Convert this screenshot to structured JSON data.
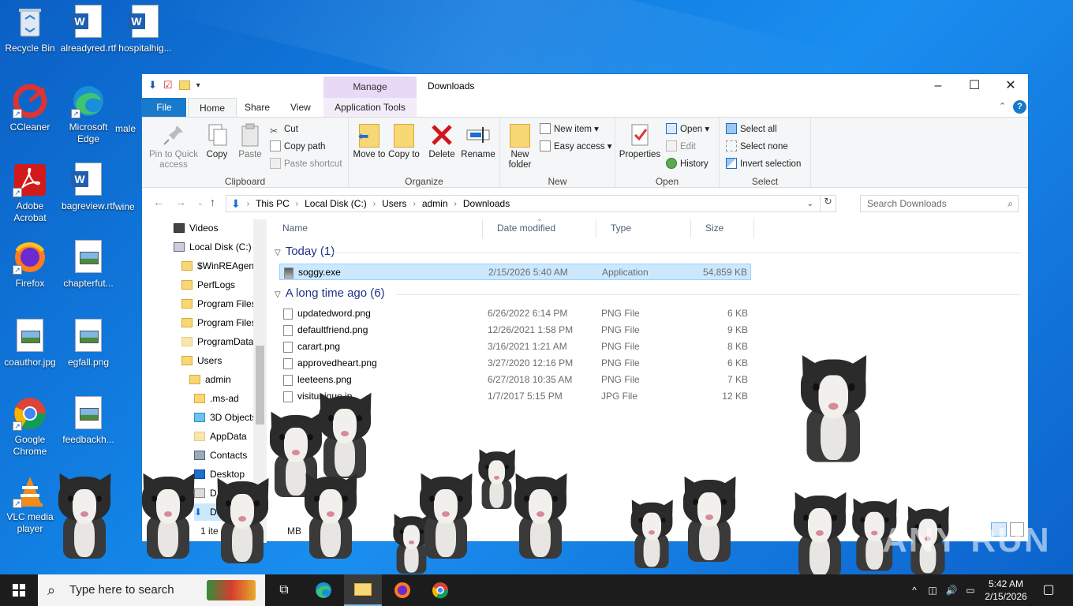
{
  "desktop": {
    "icons": [
      {
        "label": "Recycle Bin"
      },
      {
        "label": "alreadyred.rtf"
      },
      {
        "label": "hospitalhig..."
      },
      {
        "label": "CCleaner"
      },
      {
        "label": "Microsoft Edge"
      },
      {
        "label": "male"
      },
      {
        "label": "Adobe Acrobat"
      },
      {
        "label": "bagreview.rtf"
      },
      {
        "label": "wine"
      },
      {
        "label": "Firefox"
      },
      {
        "label": "chapterfut..."
      },
      {
        "label": "coauthor.jpg"
      },
      {
        "label": "egfall.png"
      },
      {
        "label": "Google Chrome"
      },
      {
        "label": "feedbackh..."
      },
      {
        "label": "VLC media player"
      }
    ]
  },
  "window": {
    "title": "Downloads",
    "context_tab": "Manage",
    "tabs": {
      "file": "File",
      "home": "Home",
      "share": "Share",
      "view": "View",
      "app_tools": "Application Tools"
    },
    "ribbon": {
      "clipboard": {
        "label": "Clipboard",
        "pin": "Pin to Quick access",
        "copy": "Copy",
        "paste": "Paste",
        "cut": "Cut",
        "copy_path": "Copy path",
        "paste_shortcut": "Paste shortcut"
      },
      "organize": {
        "label": "Organize",
        "move_to": "Move to",
        "copy_to": "Copy to",
        "delete": "Delete",
        "rename": "Rename"
      },
      "new": {
        "label": "New",
        "new_folder": "New folder",
        "new_item": "New item",
        "easy_access": "Easy access"
      },
      "open": {
        "label": "Open",
        "properties": "Properties",
        "open": "Open",
        "edit": "Edit",
        "history": "History"
      },
      "select": {
        "label": "Select",
        "select_all": "Select all",
        "select_none": "Select none",
        "invert": "Invert selection"
      }
    },
    "address": {
      "crumbs": [
        "This PC",
        "Local Disk (C:)",
        "Users",
        "admin",
        "Downloads"
      ],
      "search_placeholder": "Search Downloads"
    },
    "nav": [
      "Videos",
      "Local Disk (C:)",
      "$WinREAgent",
      "PerfLogs",
      "Program Files",
      "Program Files",
      "ProgramData",
      "Users",
      "admin",
      ".ms-ad",
      "3D Objects",
      "AppData",
      "Contacts",
      "Desktop",
      "D",
      "Do"
    ],
    "columns": {
      "name": "Name",
      "date": "Date modified",
      "type": "Type",
      "size": "Size"
    },
    "groups": [
      {
        "title": "Today (1)",
        "files": [
          {
            "name": "soggy.exe",
            "date": "2/15/2026 5:40 AM",
            "type": "Application",
            "size": "54,859 KB",
            "selected": true
          }
        ]
      },
      {
        "title": "A long time ago (6)",
        "files": [
          {
            "name": "updatedword.png",
            "date": "6/26/2022 6:14 PM",
            "type": "PNG File",
            "size": "6 KB"
          },
          {
            "name": "defaultfriend.png",
            "date": "12/26/2021 1:58 PM",
            "type": "PNG File",
            "size": "9 KB"
          },
          {
            "name": "carart.png",
            "date": "3/16/2021 1:21 AM",
            "type": "PNG File",
            "size": "8 KB"
          },
          {
            "name": "approvedheart.png",
            "date": "3/27/2020 12:16 PM",
            "type": "PNG File",
            "size": "6 KB"
          },
          {
            "name": "leeteens.png",
            "date": "6/27/2018 10:35 AM",
            "type": "PNG File",
            "size": "7 KB"
          },
          {
            "name": "visitunique.jp",
            "date": "1/7/2017 5:15 PM",
            "type": "JPG File",
            "size": "12 KB"
          }
        ]
      }
    ],
    "status": {
      "items": "1 ite",
      "size": "MB"
    }
  },
  "watermark": "ANY RUN",
  "taskbar": {
    "search_placeholder": "Type here to search",
    "time": "5:42 AM",
    "date": "2/15/2026"
  }
}
